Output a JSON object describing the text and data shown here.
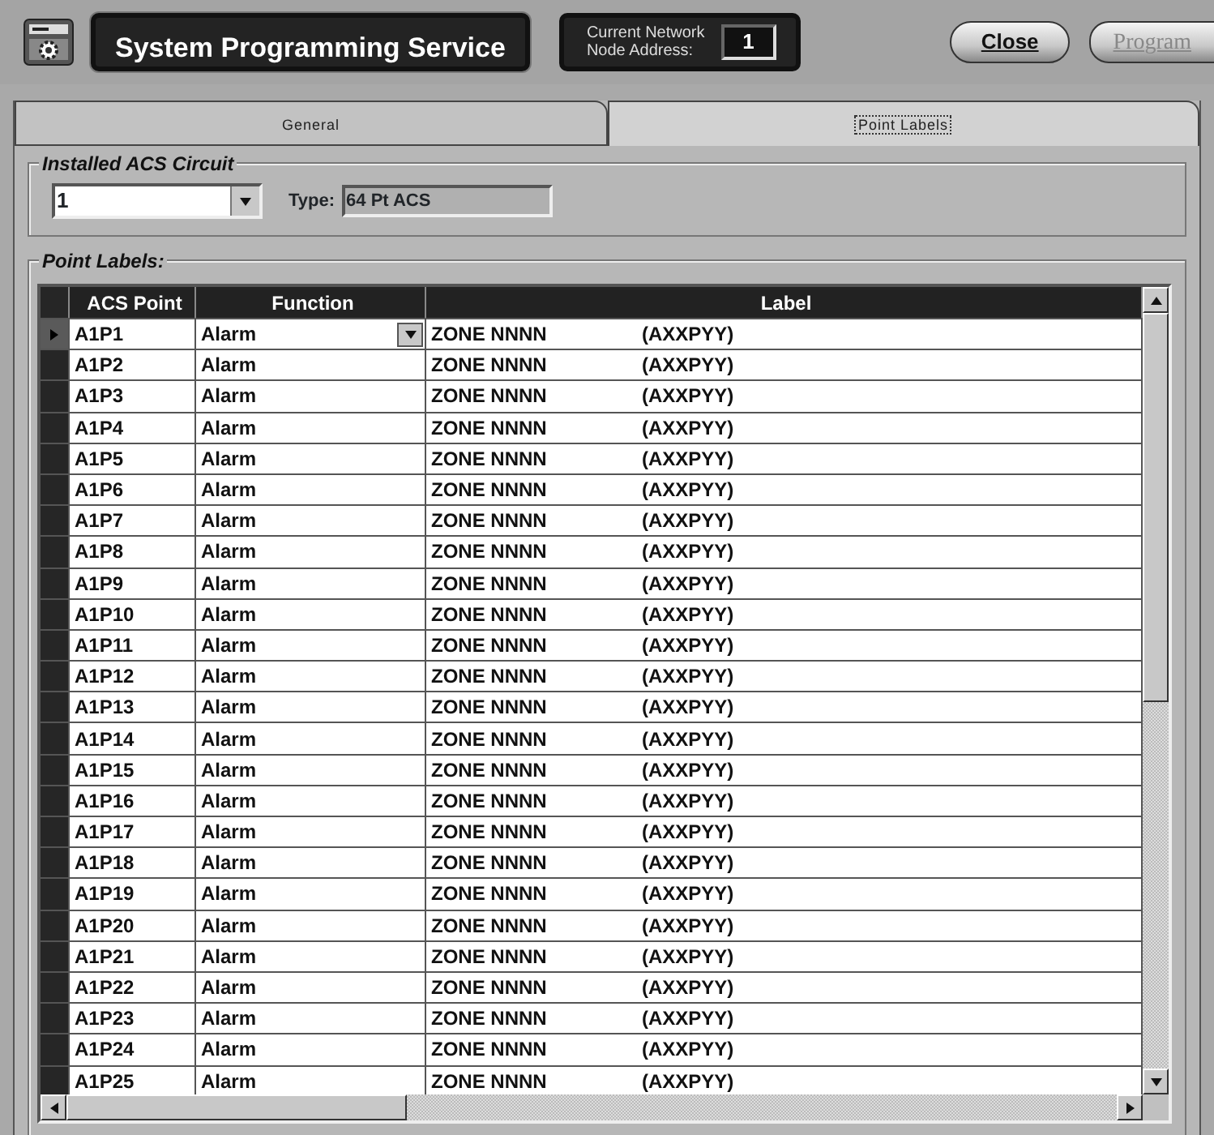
{
  "header": {
    "title": "System Programming Service",
    "network_label_line1": "Current Network",
    "network_label_line2": "Node Address:",
    "node_address": "1",
    "buttons": [
      {
        "label": "Close",
        "disabled": false
      },
      {
        "label": "Program",
        "disabled": true
      }
    ]
  },
  "tabs": [
    {
      "label": "General",
      "selected": false
    },
    {
      "label": "Point Labels",
      "selected": true
    }
  ],
  "circuit": {
    "legend": "Installed ACS Circuit",
    "value": "1",
    "type_label": "Type:",
    "type_value": "64 Pt ACS"
  },
  "point_labels": {
    "legend": "Point Labels:",
    "columns": [
      "ACS Point",
      "Function",
      "Label"
    ],
    "rows": [
      {
        "point": "A1P1",
        "function": "Alarm",
        "label_name": "ZONE NNNN",
        "label_code": "(AXXPYY)",
        "selected": true
      },
      {
        "point": "A1P2",
        "function": "Alarm",
        "label_name": "ZONE NNNN",
        "label_code": "(AXXPYY)",
        "selected": false
      },
      {
        "point": "A1P3",
        "function": "Alarm",
        "label_name": "ZONE NNNN",
        "label_code": "(AXXPYY)",
        "selected": false
      },
      {
        "point": "A1P4",
        "function": "Alarm",
        "label_name": "ZONE NNNN",
        "label_code": "(AXXPYY)",
        "selected": false
      },
      {
        "point": "A1P5",
        "function": "Alarm",
        "label_name": "ZONE NNNN",
        "label_code": "(AXXPYY)",
        "selected": false
      },
      {
        "point": "A1P6",
        "function": "Alarm",
        "label_name": "ZONE NNNN",
        "label_code": "(AXXPYY)",
        "selected": false
      },
      {
        "point": "A1P7",
        "function": "Alarm",
        "label_name": "ZONE NNNN",
        "label_code": "(AXXPYY)",
        "selected": false
      },
      {
        "point": "A1P8",
        "function": "Alarm",
        "label_name": "ZONE NNNN",
        "label_code": "(AXXPYY)",
        "selected": false
      },
      {
        "point": "A1P9",
        "function": "Alarm",
        "label_name": "ZONE NNNN",
        "label_code": "(AXXPYY)",
        "selected": false
      },
      {
        "point": "A1P10",
        "function": "Alarm",
        "label_name": "ZONE NNNN",
        "label_code": "(AXXPYY)",
        "selected": false
      },
      {
        "point": "A1P11",
        "function": "Alarm",
        "label_name": "ZONE NNNN",
        "label_code": "(AXXPYY)",
        "selected": false
      },
      {
        "point": "A1P12",
        "function": "Alarm",
        "label_name": "ZONE NNNN",
        "label_code": "(AXXPYY)",
        "selected": false
      },
      {
        "point": "A1P13",
        "function": "Alarm",
        "label_name": "ZONE NNNN",
        "label_code": "(AXXPYY)",
        "selected": false
      },
      {
        "point": "A1P14",
        "function": "Alarm",
        "label_name": "ZONE NNNN",
        "label_code": "(AXXPYY)",
        "selected": false
      },
      {
        "point": "A1P15",
        "function": "Alarm",
        "label_name": "ZONE NNNN",
        "label_code": "(AXXPYY)",
        "selected": false
      },
      {
        "point": "A1P16",
        "function": "Alarm",
        "label_name": "ZONE NNNN",
        "label_code": "(AXXPYY)",
        "selected": false
      },
      {
        "point": "A1P17",
        "function": "Alarm",
        "label_name": "ZONE NNNN",
        "label_code": "(AXXPYY)",
        "selected": false
      },
      {
        "point": "A1P18",
        "function": "Alarm",
        "label_name": "ZONE NNNN",
        "label_code": "(AXXPYY)",
        "selected": false
      },
      {
        "point": "A1P19",
        "function": "Alarm",
        "label_name": "ZONE NNNN",
        "label_code": "(AXXPYY)",
        "selected": false
      },
      {
        "point": "A1P20",
        "function": "Alarm",
        "label_name": "ZONE NNNN",
        "label_code": "(AXXPYY)",
        "selected": false
      },
      {
        "point": "A1P21",
        "function": "Alarm",
        "label_name": "ZONE NNNN",
        "label_code": "(AXXPYY)",
        "selected": false
      },
      {
        "point": "A1P22",
        "function": "Alarm",
        "label_name": "ZONE NNNN",
        "label_code": "(AXXPYY)",
        "selected": false
      },
      {
        "point": "A1P23",
        "function": "Alarm",
        "label_name": "ZONE NNNN",
        "label_code": "(AXXPYY)",
        "selected": false
      },
      {
        "point": "A1P24",
        "function": "Alarm",
        "label_name": "ZONE NNNN",
        "label_code": "(AXXPYY)",
        "selected": false
      },
      {
        "point": "A1P25",
        "function": "Alarm",
        "label_name": "ZONE NNNN",
        "label_code": "(AXXPYY)",
        "selected": false
      }
    ]
  }
}
